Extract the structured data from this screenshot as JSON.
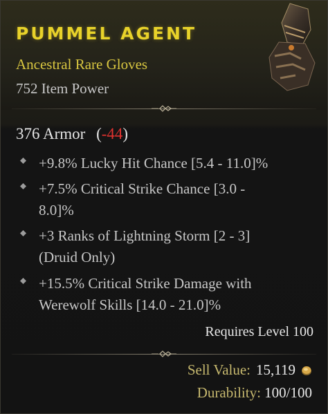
{
  "item": {
    "name": "PUMMEL AGENT",
    "type": "Ancestral Rare Gloves",
    "item_power": "752 Item Power",
    "icon": "gauntlet-icon"
  },
  "stats": {
    "armor": "376 Armor",
    "armor_open": "(",
    "armor_delta": "-44",
    "armor_close": ")"
  },
  "affixes": [
    {
      "line1": "+9.8% Lucky Hit Chance [5.4 - 11.0]%",
      "line2": ""
    },
    {
      "line1": "+7.5% Critical Strike Chance [3.0 -",
      "line2": "8.0]%"
    },
    {
      "line1": "+3 Ranks of Lightning Storm [2 - 3]",
      "line2": "(Druid Only)"
    },
    {
      "line1": "+15.5% Critical Strike Damage with",
      "line2": "Werewolf Skills [14.0 - 21.0]%"
    }
  ],
  "requirements": {
    "level": "Requires Level 100"
  },
  "footer": {
    "sell_label": "Sell Value:",
    "sell_value": "15,119",
    "durability_label": "Durability:",
    "durability_value": "100/100"
  },
  "colors": {
    "rare_title": "#e8d22a",
    "rare_subtitle": "#d8c640",
    "negative": "#e0322f",
    "footer_label": "#c6b86e"
  }
}
